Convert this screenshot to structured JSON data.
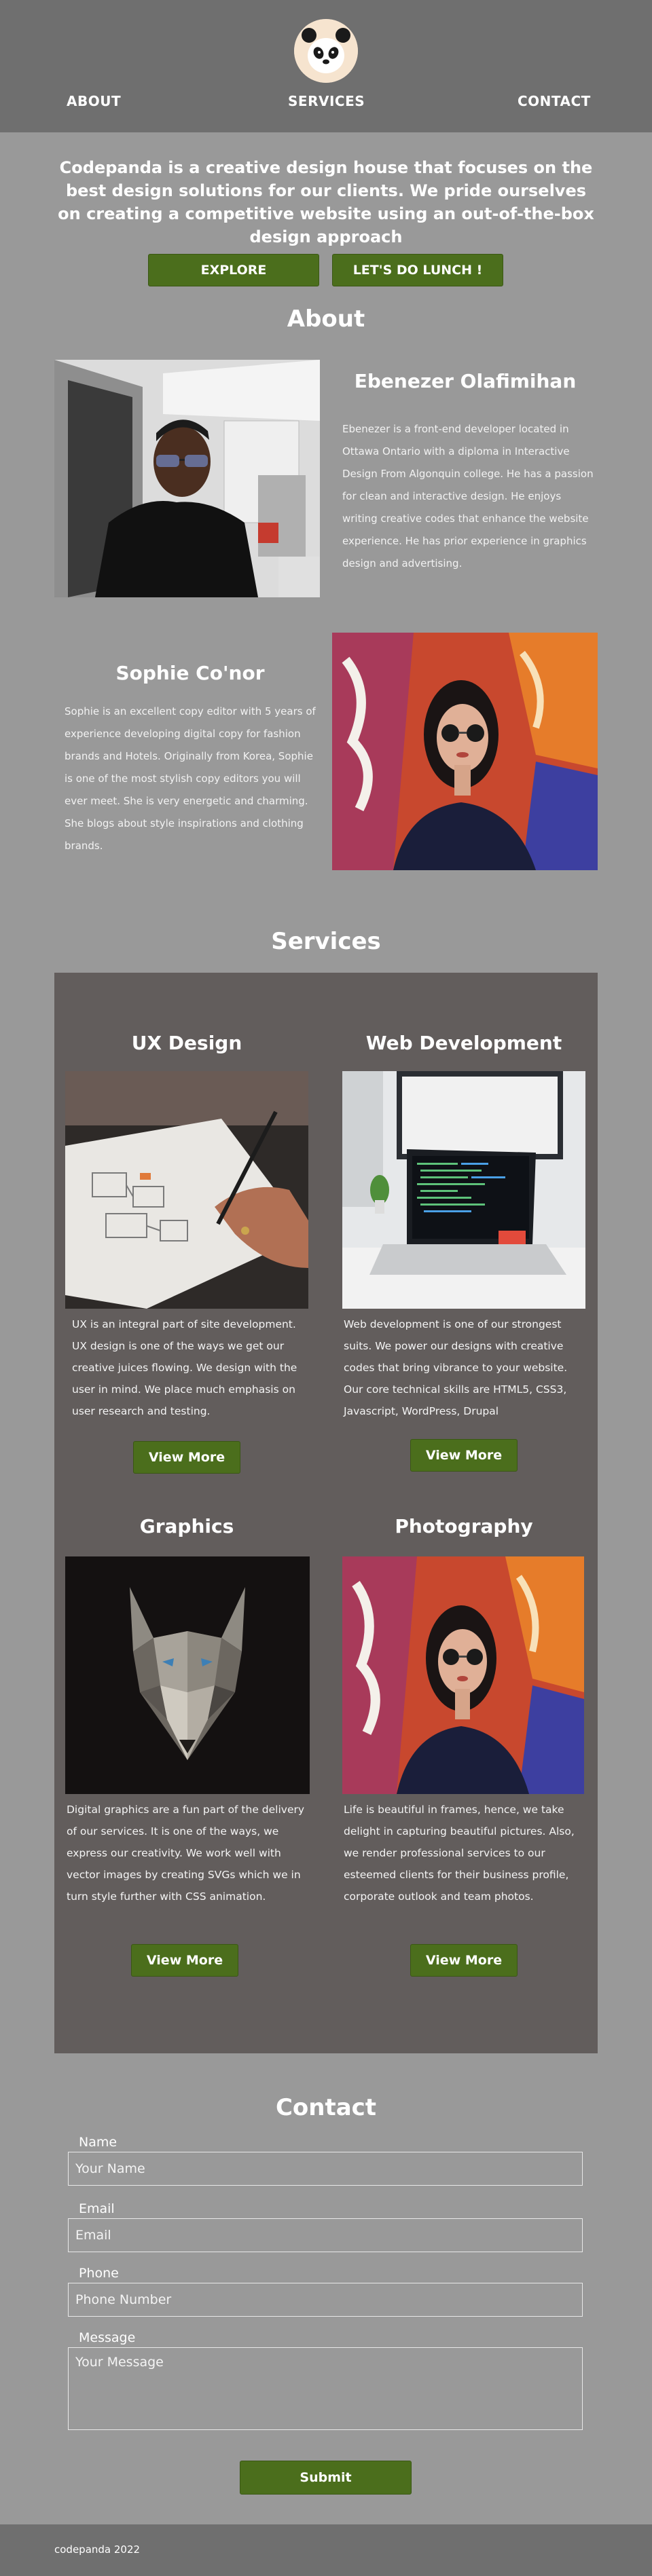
{
  "nav": {
    "about": "ABOUT",
    "services": "SERVICES",
    "contact": "CONTACT"
  },
  "hero": {
    "text": "Codepanda is a creative design house that focuses on the best design solutions for our clients. We pride ourselves on creating a competitive website using an out-of-the-box design approach",
    "explore": "EXPLORE",
    "lunch": "LET'S DO LUNCH !"
  },
  "about": {
    "title": "About",
    "people": [
      {
        "name": "Ebenezer Olafimihan",
        "bio": "Ebenezer is a front-end developer located in Ottawa Ontario with a diploma in Interactive Design From Algonquin college. He has a passion for clean and interactive design. He enjoys writing creative codes that enhance the website experience. He has prior experience in graphics design and advertising."
      },
      {
        "name": "Sophie Co'nor",
        "bio": "Sophie is an excellent copy editor with 5 years of experience developing digital copy for fashion brands and Hotels. Originally from Korea, Sophie is one of the most stylish copy editors you will ever meet. She is very energetic and charming. She blogs about style inspirations and clothing brands."
      }
    ]
  },
  "services": {
    "title": "Services",
    "items": [
      {
        "title": "UX Design",
        "desc": "UX is an integral part of site development. UX design is one of the ways we get our creative juices flowing. We design with the user in mind. We place much emphasis on user research and testing.",
        "button": "View More"
      },
      {
        "title": "Web Development",
        "desc": "Web development is one of our strongest suits. We power our designs with creative codes that bring vibrance to your website. Our core technical skills are HTML5, CSS3, Javascript, WordPress, Drupal",
        "button": "View More"
      },
      {
        "title": "Graphics",
        "desc": "Digital graphics are a fun part of the delivery of our services. It is one of the ways, we express our creativity. We work well with vector images by creating SVGs which we in turn style further with CSS animation.",
        "button": "View More"
      },
      {
        "title": "Photography",
        "desc": "Life is beautiful in frames, hence, we take delight in capturing beautiful pictures. Also, we render professional services to our esteemed clients for their business profile, corporate outlook and team photos.",
        "button": "View More"
      }
    ]
  },
  "contact": {
    "title": "Contact",
    "name_label": "Name",
    "name_placeholder": "Your Name",
    "email_label": "Email",
    "email_placeholder": "Email",
    "phone_label": "Phone",
    "phone_placeholder": "Phone Number",
    "message_label": "Message",
    "message_placeholder": "Your Message",
    "submit": "Submit"
  },
  "footer": {
    "text": "codepanda 2022"
  },
  "colors": {
    "page_bg": "#999999",
    "header_bg": "#6f6f6f",
    "panel_bg": "#625d5c",
    "button_green": "#4b6e1c"
  }
}
